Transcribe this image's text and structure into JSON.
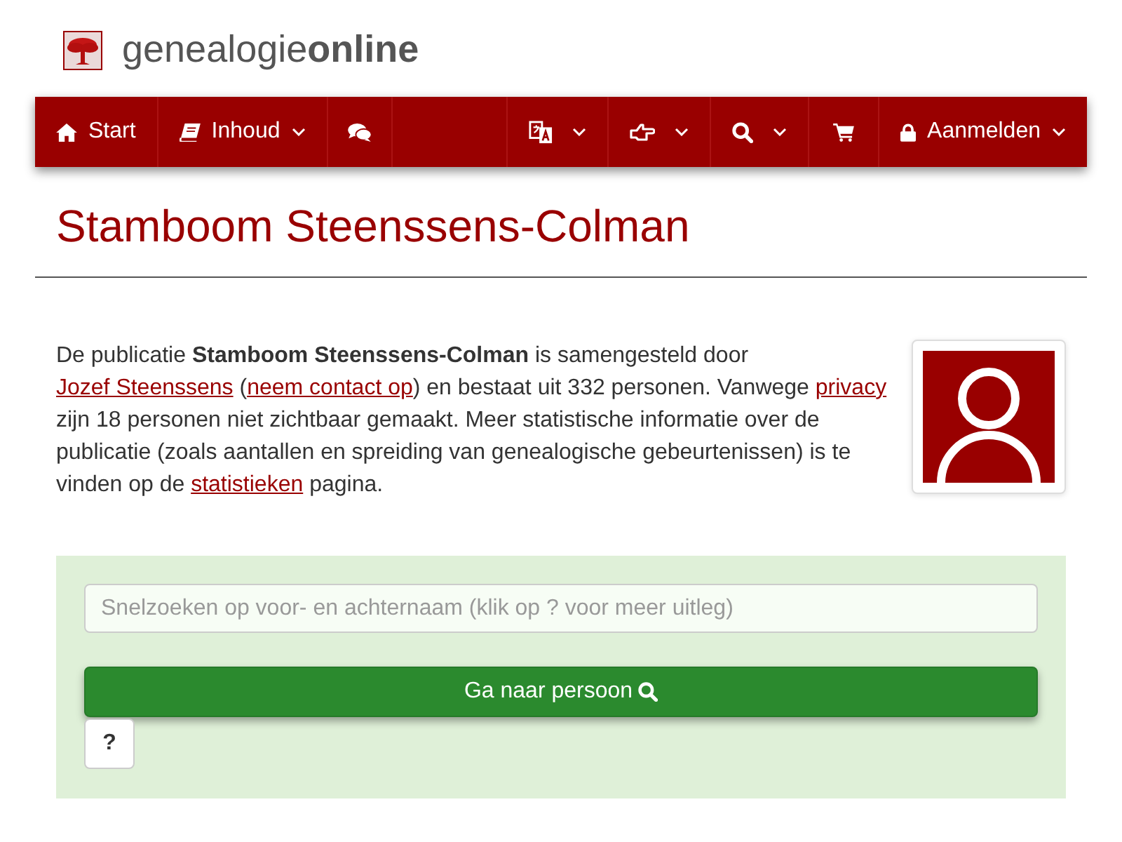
{
  "logo": {
    "text": "genealogie**online**"
  },
  "nav": {
    "left": [
      {
        "label": "Start",
        "dropdown": false
      },
      {
        "label": "Inhoud",
        "dropdown": true
      },
      {
        "dropdown": false
      }
    ],
    "right": [
      {
        "dropdown": true
      },
      {
        "dropdown": true
      },
      {
        "dropdown": true
      },
      {
        "dropdown": false
      },
      {
        "label": "Aanmelden",
        "dropdown": true
      }
    ]
  },
  "title": "Stamboom Steenssens-Colman",
  "intro": [
    {
      "kind": "text",
      "text": "De publicatie **Stamboom Steenssens-Colman** is samengesteld door "
    },
    {
      "kind": "link",
      "text": "Jozef Steenssens"
    },
    {
      "kind": "text",
      "text": " ("
    },
    {
      "kind": "link",
      "text": "neem contact op"
    },
    {
      "kind": "text",
      "text": ") en bestaat uit 332 personen. Vanwege "
    },
    {
      "kind": "link",
      "text": "privacy"
    },
    {
      "kind": "text",
      "text": " zijn 18 personen niet zichtbaar gemaakt. Meer statistische informatie over de publicatie (zoals aantallen en spreiding van genealogische gebeurtenissen) is te vinden op de "
    },
    {
      "kind": "link",
      "text": "statistieken"
    },
    {
      "kind": "text",
      "text": " pagina."
    }
  ],
  "search": {
    "placeholder": "Snelzoeken op voor- en achternaam (klik op ? voor meer uitleg)",
    "button": "Ga naar persoon",
    "help": "?"
  }
}
